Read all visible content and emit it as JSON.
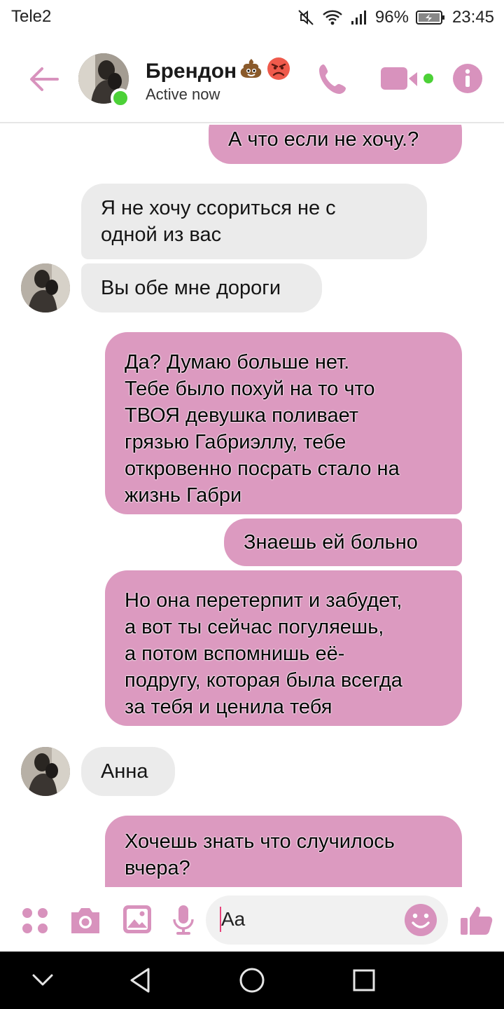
{
  "status_bar": {
    "carrier": "Tele2",
    "battery": "96%",
    "time": "23:45"
  },
  "header": {
    "contact_name": "Брендон",
    "name_emojis": [
      "pile-of-poo-emoji",
      "angry-face-emoji"
    ],
    "status": "Active now",
    "online": true
  },
  "messages": [
    {
      "dir": "out",
      "text": "А что если не хочу.?"
    },
    {
      "dir": "in",
      "text": "Я не хочу ссориться не с\nодной из вас"
    },
    {
      "dir": "in",
      "text": "Вы обе мне дороги"
    },
    {
      "dir": "out",
      "text": "Да? Думаю больше нет.\nТебе было похуй на то что\nТВОЯ девушка поливает\nгрязью Габриэллу, тебе\nоткровенно посрать стало на\nжизнь Габри"
    },
    {
      "dir": "out",
      "text": "Знаешь ей больно"
    },
    {
      "dir": "out",
      "text": "Но она перетерпит и забудет,\nа вот ты сейчас погуляешь,\nа потом вспомнишь её-\nподругу, которая была всегда\nза тебя и ценила тебя"
    },
    {
      "dir": "in",
      "text": "Анна"
    },
    {
      "dir": "out",
      "text": "Хочешь знать что случилось\nвчера?"
    }
  ],
  "composer": {
    "placeholder": "Aa",
    "icons": [
      "apps-icon",
      "camera-icon",
      "gallery-icon",
      "microphone-icon",
      "emoji-icon",
      "like-icon"
    ]
  },
  "nav_bar": {
    "icons": [
      "hide-keyboard-icon",
      "back-icon",
      "home-icon",
      "recents-icon"
    ]
  },
  "colors": {
    "accent": "#dc9ac0",
    "outgoing_bubble": "#dc9ac0",
    "incoming_bubble": "#ebebeb",
    "online": "#4cd137"
  }
}
